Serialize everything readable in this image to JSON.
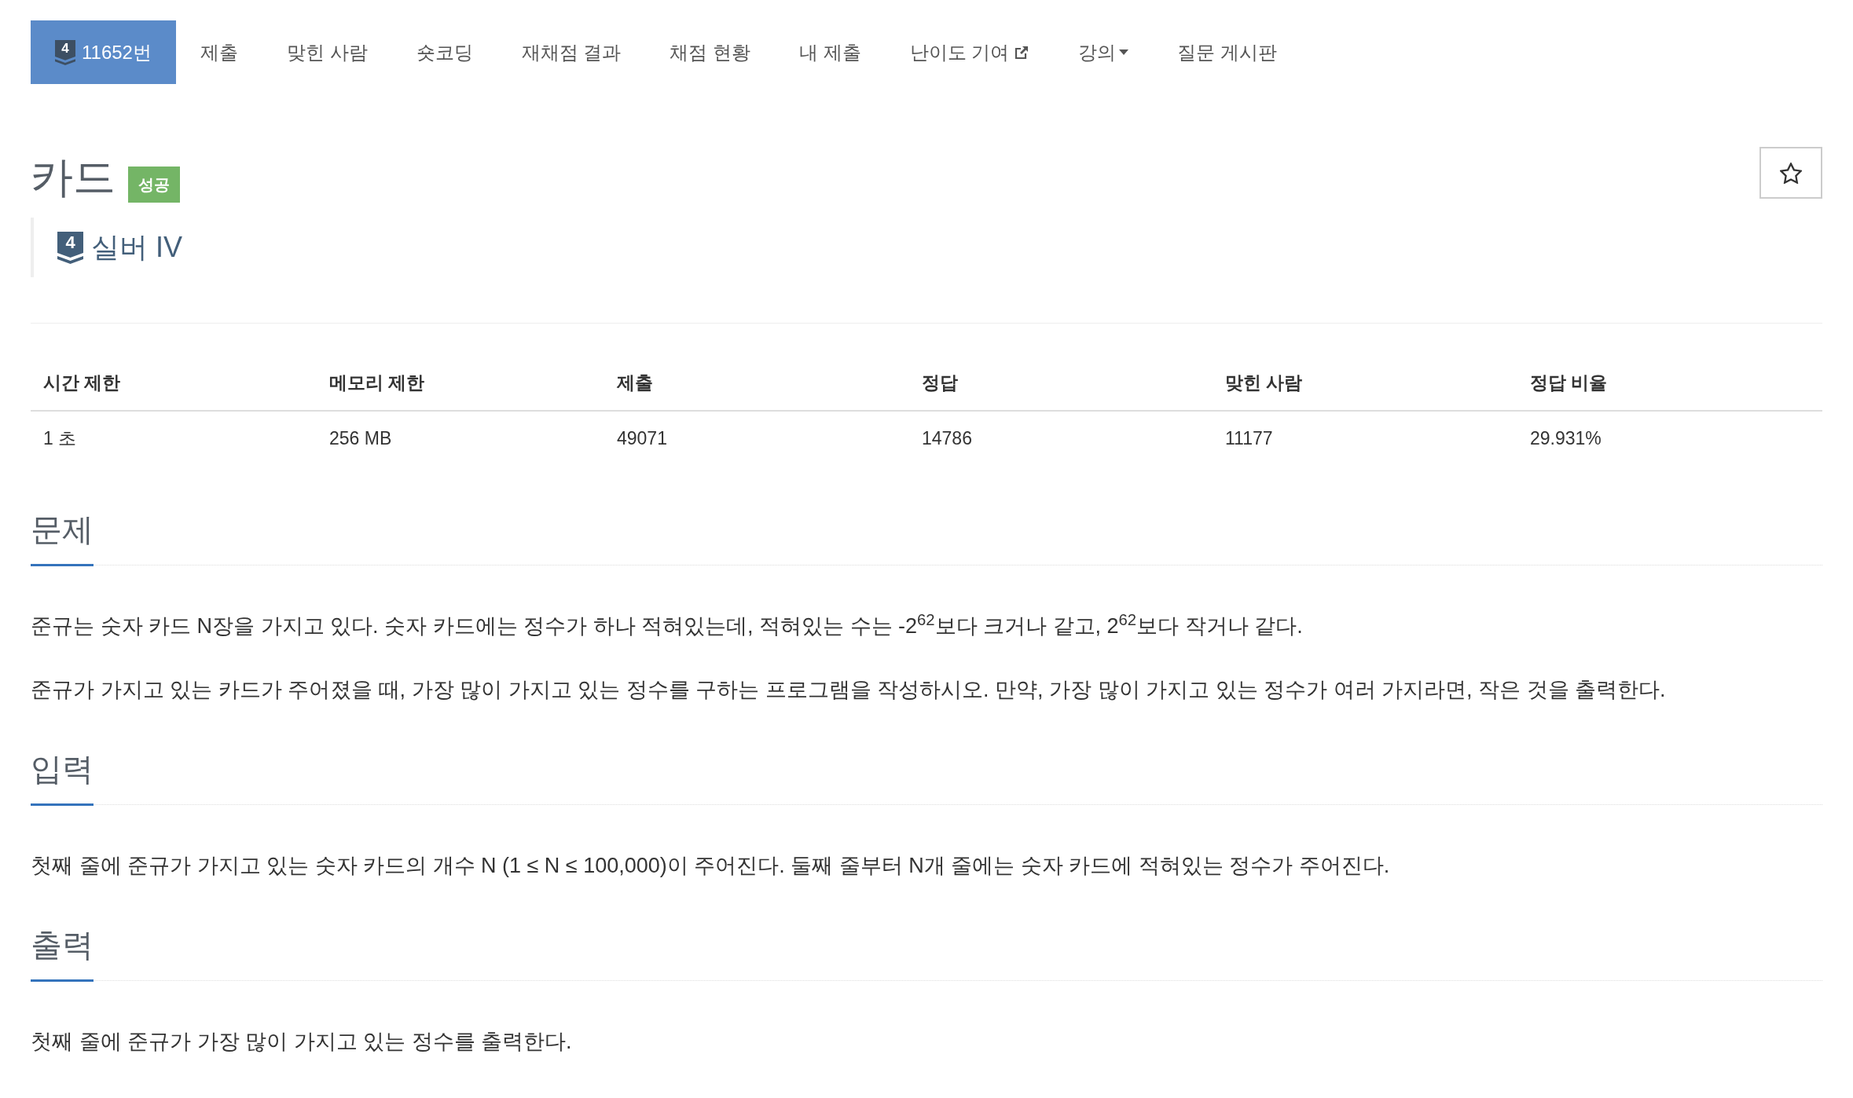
{
  "nav": {
    "tabs": [
      {
        "kind": "problem",
        "label": "11652번",
        "tier_badge": "4",
        "selected": true
      },
      {
        "kind": "link",
        "label": "제출",
        "selected": false
      },
      {
        "kind": "link",
        "label": "맞힌 사람",
        "selected": false
      },
      {
        "kind": "link",
        "label": "숏코딩",
        "selected": false
      },
      {
        "kind": "link",
        "label": "재채점 결과",
        "selected": false
      },
      {
        "kind": "link",
        "label": "채점 현황",
        "selected": false
      },
      {
        "kind": "link",
        "label": "내 제출",
        "selected": false
      },
      {
        "kind": "external",
        "label": "난이도 기여",
        "selected": false
      },
      {
        "kind": "dropdown",
        "label": "강의",
        "selected": false
      },
      {
        "kind": "link",
        "label": "질문 게시판",
        "selected": false
      }
    ]
  },
  "problem": {
    "title": "카드",
    "result_label": "성공",
    "tier": {
      "badge": "4",
      "name": "실버 IV"
    },
    "star_button": {
      "starred": false
    }
  },
  "info_table": {
    "columns": [
      "시간 제한",
      "메모리 제한",
      "제출",
      "정답",
      "맞힌 사람",
      "정답 비율"
    ],
    "rows": [
      [
        "1 초",
        "256 MB",
        "49071",
        "14786",
        "11177",
        "29.931%"
      ]
    ]
  },
  "sections": [
    {
      "heading": "문제",
      "paragraphs": [
        "준규는 숫자 카드 N장을 가지고 있다. 숫자 카드에는 정수가 하나 적혀있는데, 적혀있는 수는 -2$^{62}$보다 크거나 같고, 2$^{62}$보다 작거나 같다.",
        "준규가 가지고 있는 카드가 주어졌을 때, 가장 많이 가지고 있는 정수를 구하는 프로그램을 작성하시오. 만약, 가장 많이 가지고 있는 정수가 여러 가지라면, 작은 것을 출력한다."
      ]
    },
    {
      "heading": "입력",
      "paragraphs": [
        "첫째 줄에 준규가 가지고 있는 숫자 카드의 개수 N (1 ≤ N ≤ 100,000)이 주어진다. 둘째 줄부터 N개 줄에는 숫자 카드에 적혀있는 정수가 주어진다."
      ]
    },
    {
      "heading": "출력",
      "paragraphs": [
        "첫째 줄에 준규가 가장 많이 가지고 있는 정수를 출력한다."
      ]
    }
  ]
}
